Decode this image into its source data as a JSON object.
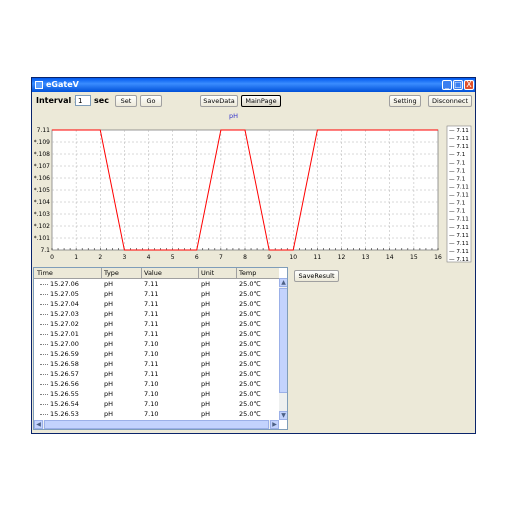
{
  "window": {
    "title": "eGateV",
    "minimize_glyph": "_",
    "maximize_glyph": "□",
    "close_glyph": "X"
  },
  "toolbar": {
    "interval_label": "Interval :",
    "interval_value": "1",
    "sec_label": "sec",
    "set_label": "Set",
    "go_label": "Go",
    "savedata_label": "SaveData",
    "mainpage_label": "MainPage",
    "setting_label": "Setting",
    "disconnect_label": "Disconnect"
  },
  "chart_data": {
    "type": "line",
    "title": "pH",
    "x": [
      0,
      1,
      2,
      3,
      4,
      5,
      6,
      7,
      8,
      9,
      10,
      11,
      12,
      13,
      14,
      15,
      16
    ],
    "xlim": [
      0,
      16
    ],
    "ylim": [
      7.1,
      7.11
    ],
    "y_tick_labels": [
      "7.11",
      "*.109",
      "*.108",
      "*.107",
      "*.106",
      "*.105",
      "*.104",
      "*.103",
      "*.102",
      "*.101",
      "7.1"
    ],
    "x_tick_labels": [
      "0",
      "1",
      "2",
      "3",
      "4",
      "5",
      "6",
      "7",
      "8",
      "9",
      "10",
      "11",
      "12",
      "13",
      "14",
      "15",
      "16"
    ],
    "series": [
      {
        "color": "#ff0000",
        "values": [
          7.11,
          7.11,
          7.11,
          7.1,
          7.1,
          7.1,
          7.1,
          7.11,
          7.11,
          7.1,
          7.1,
          7.11,
          7.11,
          7.11,
          7.11,
          7.11,
          7.11
        ]
      }
    ],
    "grid": true,
    "side_list": [
      "7.11",
      "7.11",
      "7.11",
      "7.1",
      "7.1",
      "7.1",
      "7.1",
      "7.11",
      "7.11",
      "7.1",
      "7.1",
      "7.11",
      "7.11",
      "7.11",
      "7.11",
      "7.11",
      "7.11"
    ]
  },
  "table": {
    "columns": [
      "Time",
      "Type",
      "Value",
      "Unit",
      "Temp"
    ],
    "rows": [
      {
        "time": "15.27.06",
        "type": "pH",
        "value": "7.11",
        "unit": "pH",
        "temp": "25.0℃"
      },
      {
        "time": "15.27.05",
        "type": "pH",
        "value": "7.11",
        "unit": "pH",
        "temp": "25.0℃"
      },
      {
        "time": "15.27.04",
        "type": "pH",
        "value": "7.11",
        "unit": "pH",
        "temp": "25.0℃"
      },
      {
        "time": "15.27.03",
        "type": "pH",
        "value": "7.11",
        "unit": "pH",
        "temp": "25.0℃"
      },
      {
        "time": "15.27.02",
        "type": "pH",
        "value": "7.11",
        "unit": "pH",
        "temp": "25.0℃"
      },
      {
        "time": "15.27.01",
        "type": "pH",
        "value": "7.11",
        "unit": "pH",
        "temp": "25.0℃"
      },
      {
        "time": "15.27.00",
        "type": "pH",
        "value": "7.10",
        "unit": "pH",
        "temp": "25.0℃"
      },
      {
        "time": "15.26.59",
        "type": "pH",
        "value": "7.10",
        "unit": "pH",
        "temp": "25.0℃"
      },
      {
        "time": "15.26.58",
        "type": "pH",
        "value": "7.11",
        "unit": "pH",
        "temp": "25.0℃"
      },
      {
        "time": "15.26.57",
        "type": "pH",
        "value": "7.11",
        "unit": "pH",
        "temp": "25.0℃"
      },
      {
        "time": "15.26.56",
        "type": "pH",
        "value": "7.10",
        "unit": "pH",
        "temp": "25.0℃"
      },
      {
        "time": "15.26.55",
        "type": "pH",
        "value": "7.10",
        "unit": "pH",
        "temp": "25.0℃"
      },
      {
        "time": "15.26.54",
        "type": "pH",
        "value": "7.10",
        "unit": "pH",
        "temp": "25.0℃"
      },
      {
        "time": "15.26.53",
        "type": "pH",
        "value": "7.10",
        "unit": "pH",
        "temp": "25.0℃"
      }
    ]
  },
  "save_result_label": "SaveResult",
  "colors": {
    "titlebar": "#0058ee",
    "series_line": "#ff0000",
    "window_bg": "#ece9d8"
  }
}
